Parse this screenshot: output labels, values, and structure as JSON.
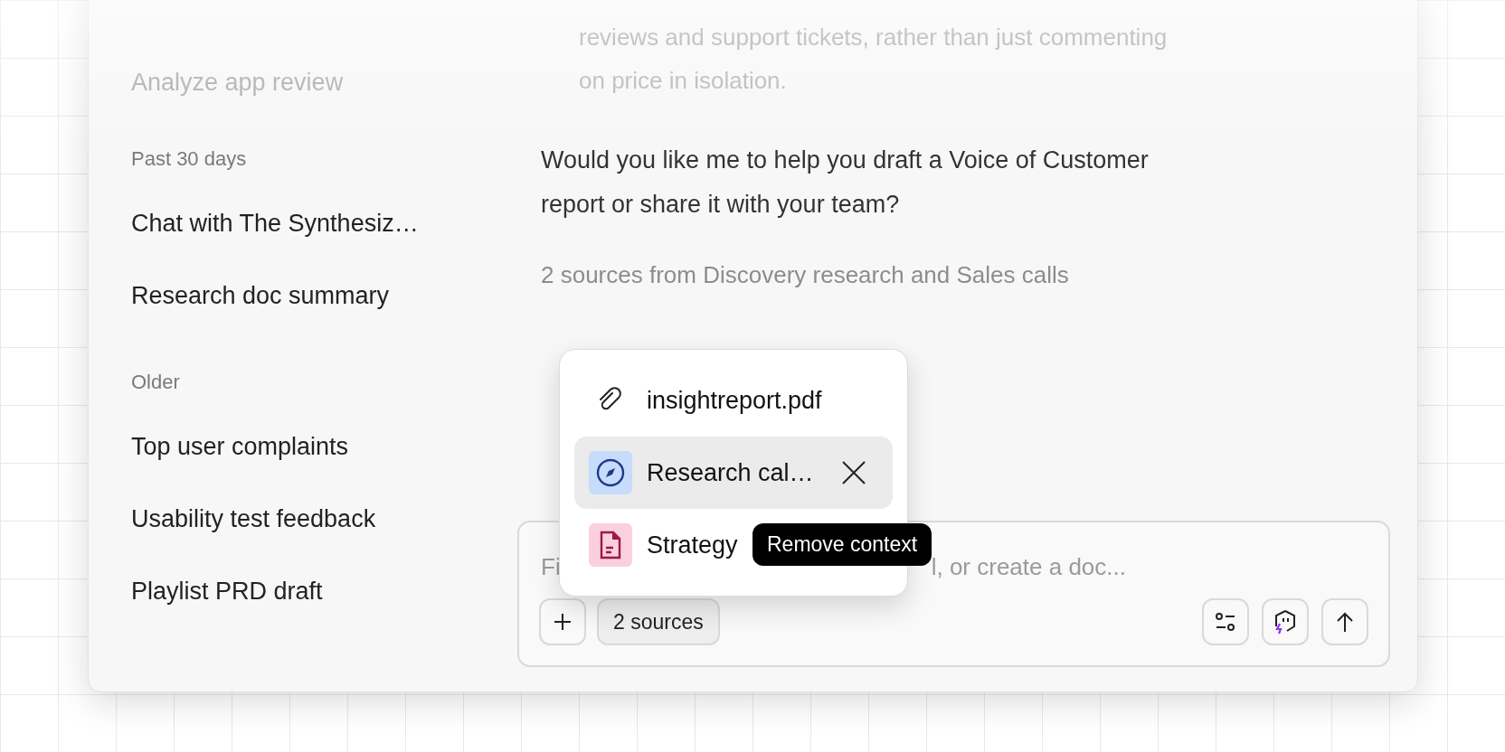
{
  "sidebar": {
    "faded_item": "Analyze app review",
    "groups": [
      {
        "heading": "Past 30 days",
        "items": [
          {
            "label": "Chat with The Synthesiz…"
          },
          {
            "label": "Research doc summary"
          }
        ]
      },
      {
        "heading": "Older",
        "items": [
          {
            "label": "Top user complaints"
          },
          {
            "label": "Usability test feedback"
          },
          {
            "label": "Playlist PRD draft"
          }
        ]
      }
    ]
  },
  "chat": {
    "faded_lines": [
      "reviews and support tickets, rather than just commenting",
      "on price in isolation."
    ],
    "message_lines": [
      "Would you like me to help you draft a Voice of Customer",
      "report or share it with your team?"
    ],
    "sources_note": "2 sources from Discovery research and Sales calls"
  },
  "sources_popup": {
    "items": [
      {
        "kind": "attachment",
        "label": "insightreport.pdf",
        "hovered": false
      },
      {
        "kind": "compass",
        "label": "Research cal…",
        "hovered": true
      },
      {
        "kind": "document",
        "label": "Strategy",
        "hovered": false
      }
    ],
    "tooltip": "Remove context"
  },
  "composer": {
    "placeholder_start": "Fi",
    "placeholder_end": "l, or create a doc...",
    "sources_button": "2 sources"
  }
}
